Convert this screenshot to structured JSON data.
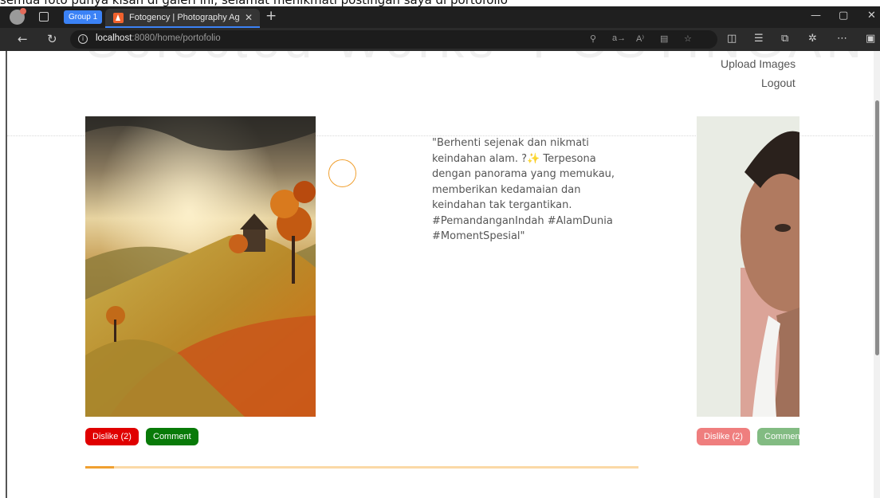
{
  "top_strip": {
    "text": "semua foto punya kisah di galeri ini, selamat menikmati postingan saya di portofolio"
  },
  "browser": {
    "group_label": "Group 1",
    "tab_title": "Fotogency | Photography Agency",
    "url_host": "localhost",
    "url_path": ":8080/home/portofolio"
  },
  "page": {
    "bg_left": "Selected Works",
    "bg_right": "POSTINGAN",
    "nav": {
      "upload": "Upload Images",
      "logout": "Logout"
    },
    "slides": [
      {
        "caption": "\"Berhenti sejenak dan nikmati keindahan alam. ?✨ Terpesona dengan panorama yang memukau, memberikan kedamaian dan keindahan tak tergantikan. #PemandanganIndah #AlamDunia #MomentSpesial\"",
        "dislike_label": "Dislike (2)",
        "comment_label": "Comment"
      },
      {
        "dislike_label": "Dislike (2)",
        "comment_label": "Comment"
      }
    ],
    "progress": 0.052
  },
  "colors": {
    "dislike": "#e00000",
    "comment": "#087a08",
    "accent": "#f0a030"
  }
}
